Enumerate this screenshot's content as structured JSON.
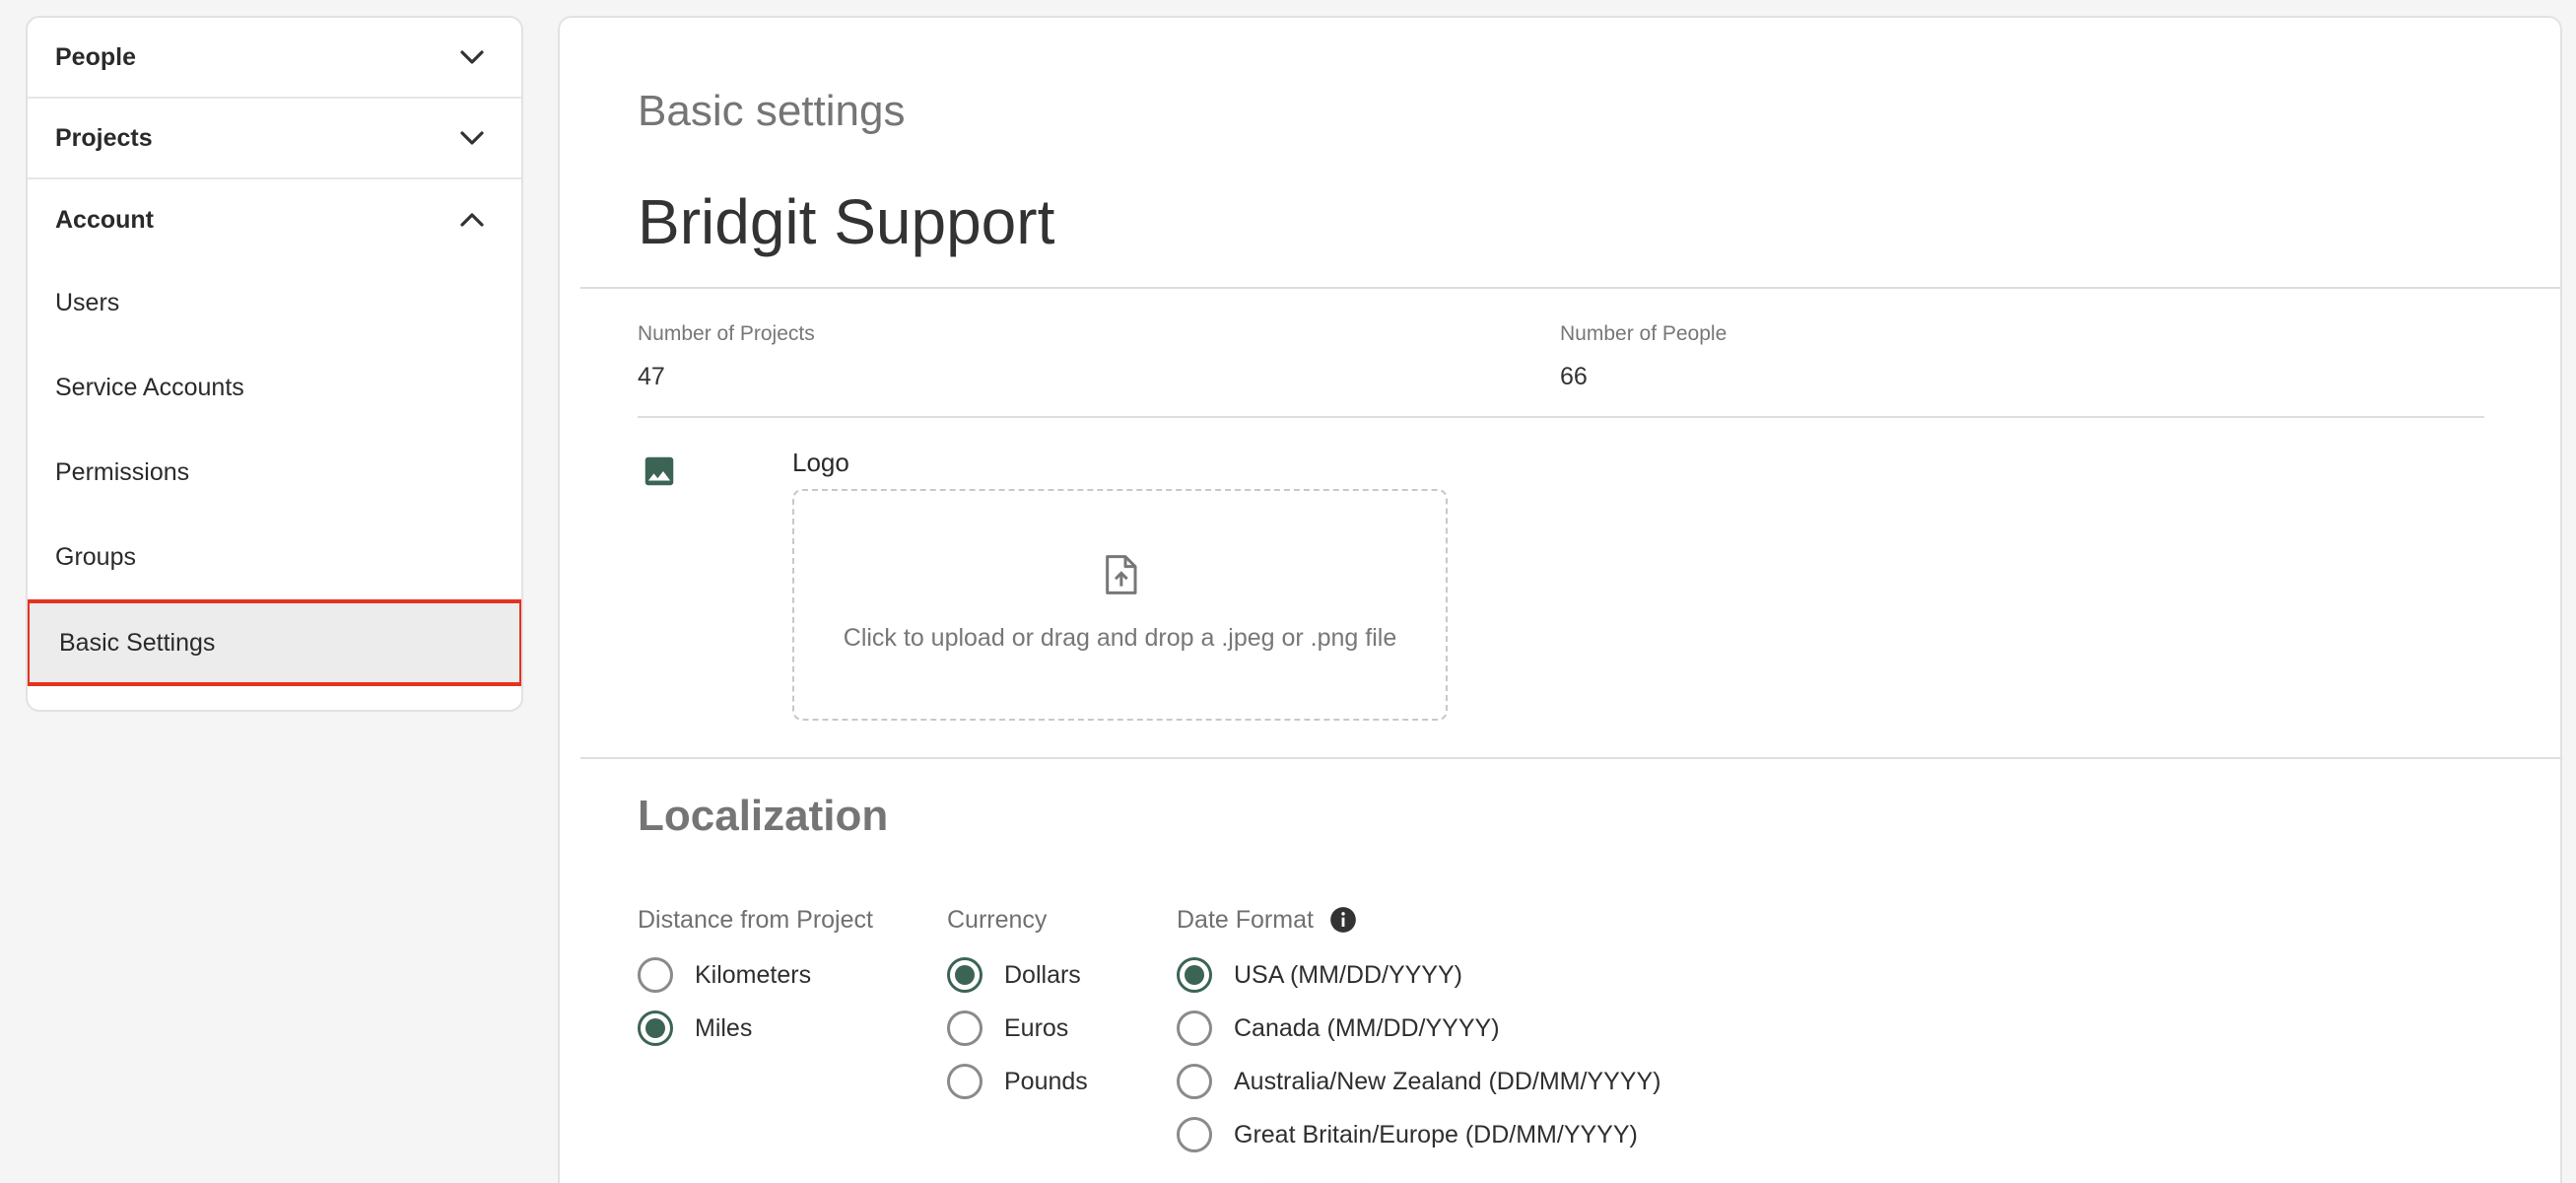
{
  "sidebar": {
    "sections": [
      {
        "label": "People",
        "state": "collapsed"
      },
      {
        "label": "Projects",
        "state": "collapsed"
      },
      {
        "label": "Account",
        "state": "expanded"
      }
    ],
    "items": [
      {
        "label": "Users"
      },
      {
        "label": "Service Accounts"
      },
      {
        "label": "Permissions"
      },
      {
        "label": "Groups"
      },
      {
        "label": "Basic Settings",
        "active": true
      }
    ]
  },
  "main": {
    "page_title": "Basic settings",
    "org_name": "Bridgit Support",
    "stats": {
      "projects_label": "Number of Projects",
      "projects_value": "47",
      "people_label": "Number of People",
      "people_value": "66"
    },
    "logo": {
      "label": "Logo",
      "upload_text": "Click to upload or drag and drop a .jpeg or .png file"
    },
    "localization": {
      "title": "Localization",
      "distance": {
        "label": "Distance from Project",
        "options": [
          {
            "label": "Kilometers",
            "checked": false
          },
          {
            "label": "Miles",
            "checked": true
          }
        ]
      },
      "currency": {
        "label": "Currency",
        "options": [
          {
            "label": "Dollars",
            "checked": true
          },
          {
            "label": "Euros",
            "checked": false
          },
          {
            "label": "Pounds",
            "checked": false
          }
        ]
      },
      "date_format": {
        "label": "Date Format",
        "options": [
          {
            "label": "USA (MM/DD/YYYY)",
            "checked": true
          },
          {
            "label": "Canada (MM/DD/YYYY)",
            "checked": false
          },
          {
            "label": "Australia/New Zealand (DD/MM/YYYY)",
            "checked": false
          },
          {
            "label": "Great Britain/Europe (DD/MM/YYYY)",
            "checked": false
          }
        ]
      }
    }
  },
  "colors": {
    "accent": "#3c6454",
    "highlight": "#e5321e"
  },
  "icons": [
    "chevron-down-icon",
    "chevron-up-icon",
    "image-icon",
    "upload-file-icon",
    "info-icon"
  ]
}
